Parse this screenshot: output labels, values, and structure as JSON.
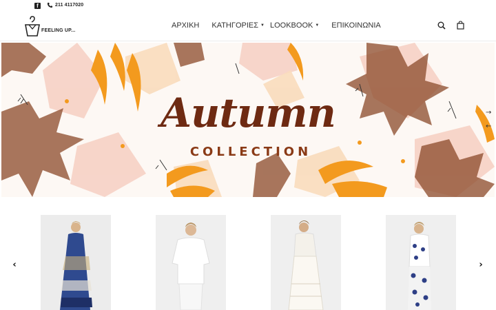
{
  "topbar": {
    "phone": "211 4117020",
    "social_icon": "facebook-icon"
  },
  "brand": {
    "logo_text": "FEELING UP..."
  },
  "nav": {
    "items": [
      {
        "label": "ΑΡΧΙΚΗ",
        "dropdown": false
      },
      {
        "label": "ΚΑΤΗΓΟΡΙΕΣ",
        "dropdown": true
      },
      {
        "label": "LOOKBOOK",
        "dropdown": true
      },
      {
        "label": "ΕΠΙΚΟΙΝΩΝΙΑ",
        "dropdown": false
      }
    ]
  },
  "hero": {
    "title": "Autumn",
    "subtitle": "COLLECTION",
    "next_arrow": "→",
    "prev_arrow": "←"
  },
  "carousel": {
    "prev_label": "‹",
    "next_label": "›",
    "products": [
      {
        "name": "blue printed maxi dress",
        "image": "product-photo"
      },
      {
        "name": "white blouse",
        "image": "product-photo"
      },
      {
        "name": "white lace set",
        "image": "product-photo"
      },
      {
        "name": "printed jumpsuit",
        "image": "product-photo"
      }
    ]
  },
  "colors": {
    "brown_dark": "#6e2a12",
    "brown": "#8a3a16",
    "orange": "#f39a1e",
    "pink_leaf": "#f2b8a8"
  }
}
